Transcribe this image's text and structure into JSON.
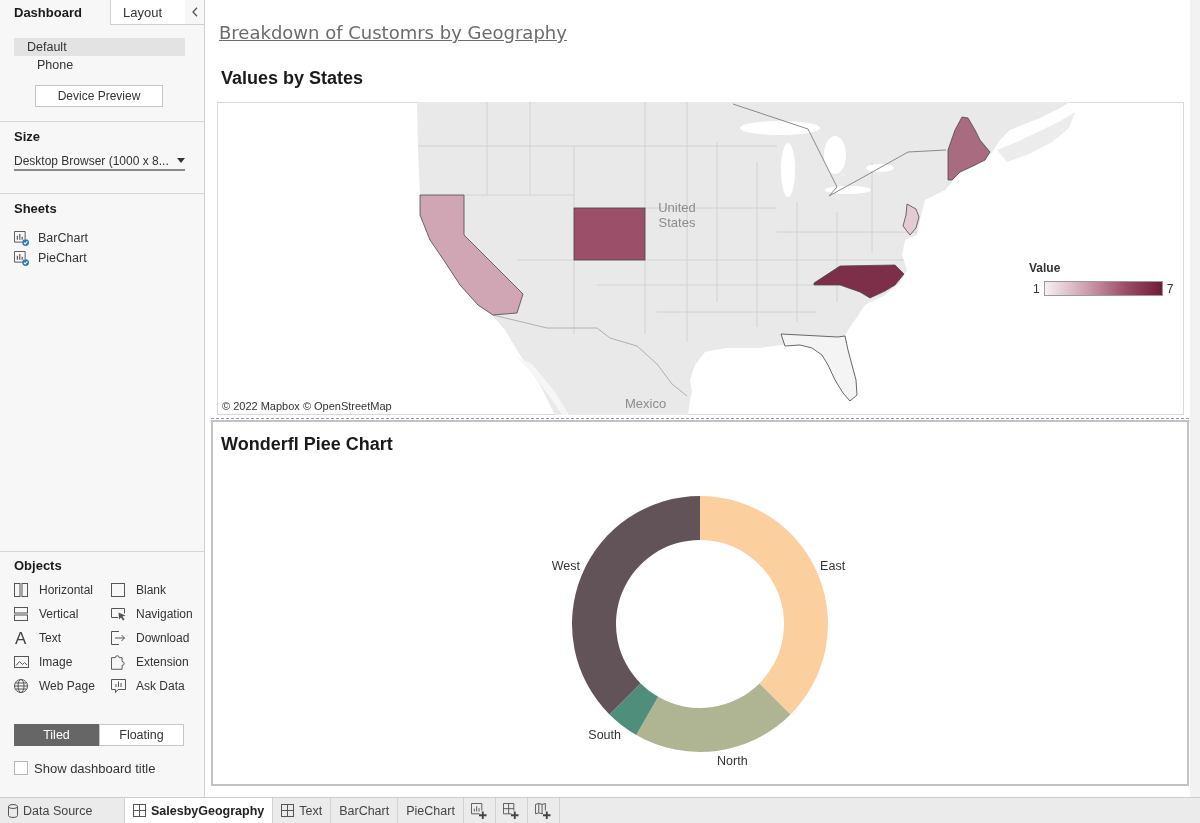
{
  "sidebar": {
    "tabs": [
      {
        "label": "Dashboard",
        "selected": true
      },
      {
        "label": "Layout",
        "selected": false
      }
    ],
    "devices": [
      {
        "label": "Default",
        "selected": true
      },
      {
        "label": "Phone",
        "selected": false
      }
    ],
    "device_preview_button": "Device Preview",
    "size": {
      "heading": "Size",
      "value": "Desktop Browser (1000 x 8..."
    },
    "sheets": {
      "heading": "Sheets",
      "items": [
        "BarChart",
        "PieChart"
      ]
    },
    "objects": {
      "heading": "Objects",
      "items": [
        {
          "label": "Horizontal",
          "kind": "horizontal"
        },
        {
          "label": "Blank",
          "kind": "blank"
        },
        {
          "label": "Vertical",
          "kind": "vertical"
        },
        {
          "label": "Navigation",
          "kind": "navigation"
        },
        {
          "label": "Text",
          "kind": "text",
          "glyph": "A"
        },
        {
          "label": "Download",
          "kind": "download"
        },
        {
          "label": "Image",
          "kind": "image"
        },
        {
          "label": "Extension",
          "kind": "extension"
        },
        {
          "label": "Web Page",
          "kind": "web_page"
        },
        {
          "label": "Ask Data",
          "kind": "ask_data"
        }
      ]
    },
    "layout_mode": [
      {
        "label": "Tiled",
        "selected": true
      },
      {
        "label": "Floating",
        "selected": false
      }
    ],
    "show_dashboard_title": {
      "label": "Show dashboard title",
      "checked": false
    }
  },
  "dashboard": {
    "title": "Breakdown of Customrs by Geography",
    "map_sheet": {
      "title": "Values by States",
      "place_labels": [
        "United States",
        "Mexico"
      ],
      "attribution": "© 2022 Mapbox © OpenStreetMap",
      "legend": {
        "title": "Value",
        "min": "1",
        "max": "7"
      }
    },
    "pie_sheet": {
      "title": "Wonderfl Piee Chart",
      "chart_data": [
        {
          "type": "donut",
          "categories": [
            "East",
            "North",
            "South",
            "West"
          ],
          "values": [
            37.5,
            20.8,
            4.2,
            37.5
          ],
          "colors": [
            "#fbcf9e",
            "#afb593",
            "#4f8e7b",
            "#625359"
          ]
        }
      ]
    }
  },
  "sheet_tabs": [
    {
      "label": "Data Source",
      "kind": "data_source",
      "selected": false
    },
    {
      "label": "SalesbyGeography",
      "kind": "dashboard",
      "selected": true
    },
    {
      "label": "Text",
      "kind": "dashboard",
      "selected": false
    },
    {
      "label": "BarChart",
      "kind": "worksheet",
      "selected": false
    },
    {
      "label": "PieChart",
      "kind": "worksheet",
      "selected": false
    }
  ]
}
